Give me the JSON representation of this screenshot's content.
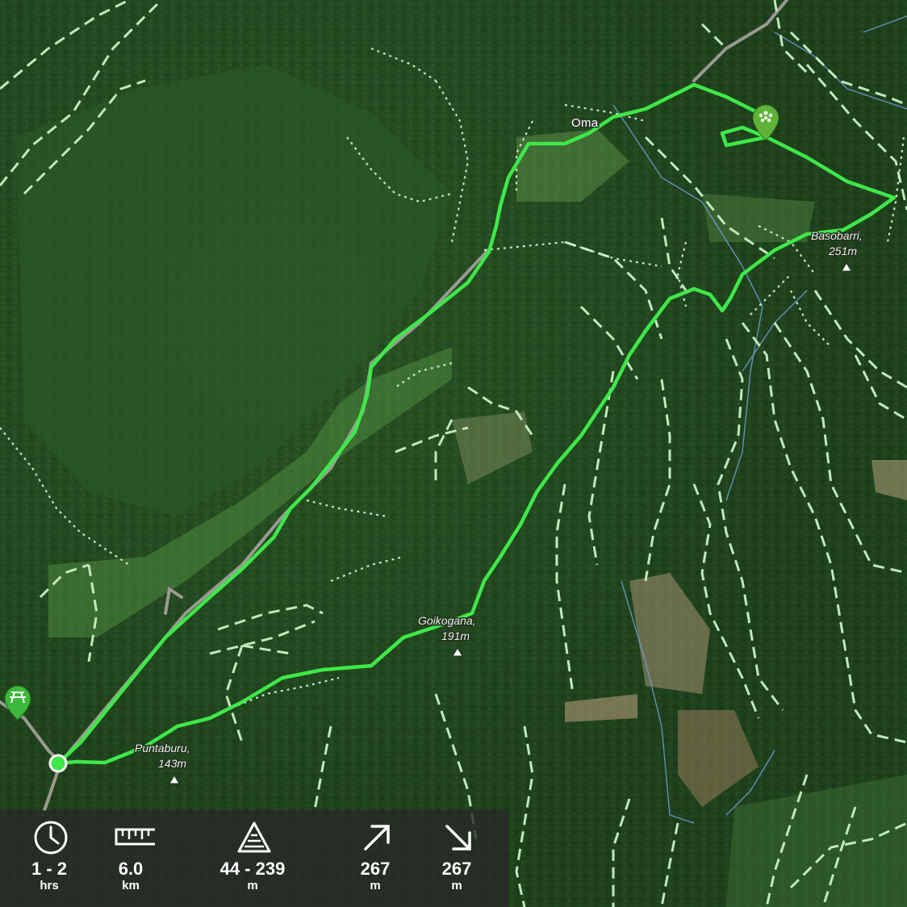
{
  "map": {
    "places": [
      {
        "name": "Oma"
      }
    ],
    "peaks": [
      {
        "name": "Basobarri,",
        "elevation": "251m"
      },
      {
        "name": "Goikogana,",
        "elevation": "191m"
      },
      {
        "name": "Puntaburu,",
        "elevation": "143m"
      }
    ],
    "markers": {
      "start_icon": "picnic-table-icon",
      "poi_icon": "viewpoint-pin-icon",
      "route_color": "#3ee84a",
      "trail_color": "#c8f2c4",
      "stream_color": "#6f9fd8"
    }
  },
  "stats": {
    "duration": {
      "value": "1 - 2",
      "unit": "hrs",
      "icon": "clock-icon"
    },
    "distance": {
      "value": "6.0",
      "unit": "km",
      "icon": "ruler-icon"
    },
    "elevation_range": {
      "value": "44 - 239",
      "unit": "m",
      "icon": "elevation-icon"
    },
    "ascent": {
      "value": "267",
      "unit": "m",
      "icon": "ascent-arrow-icon"
    },
    "descent": {
      "value": "267",
      "unit": "m",
      "icon": "descent-arrow-icon"
    }
  }
}
